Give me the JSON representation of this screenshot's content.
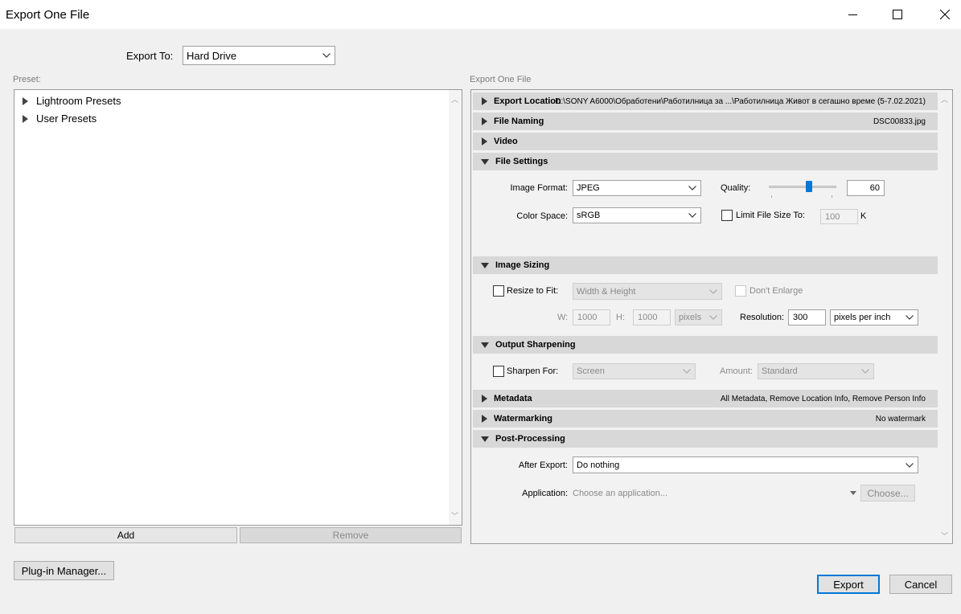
{
  "window": {
    "title": "Export One File"
  },
  "export_to": {
    "label": "Export To:",
    "value": "Hard Drive"
  },
  "preset": {
    "label": "Preset:",
    "items": [
      "Lightroom Presets",
      "User Presets"
    ],
    "add_label": "Add",
    "remove_label": "Remove"
  },
  "plugin_manager_label": "Plug-in Manager...",
  "right": {
    "label": "Export One File",
    "export_location": {
      "title": "Export Location",
      "summary": "D:\\SONY A6000\\Обработени\\Работилница за ...\\Работилница Живот в сегашно време (5-7.02.2021)"
    },
    "file_naming": {
      "title": "File Naming",
      "summary": "DSC00833.jpg"
    },
    "video": {
      "title": "Video"
    },
    "file_settings": {
      "title": "File Settings",
      "image_format_label": "Image Format:",
      "image_format": "JPEG",
      "quality_label": "Quality:",
      "quality": "60",
      "quality_level": 0.6,
      "color_space_label": "Color Space:",
      "color_space": "sRGB",
      "limit_label": "Limit File Size To:",
      "limit_value": "100",
      "limit_unit": "K"
    },
    "image_sizing": {
      "title": "Image Sizing",
      "resize_label": "Resize to Fit:",
      "resize_mode": "Width & Height",
      "dont_enlarge_label": "Don't Enlarge",
      "w_label": "W:",
      "w_value": "1000",
      "h_label": "H:",
      "h_value": "1000",
      "unit": "pixels",
      "resolution_label": "Resolution:",
      "resolution": "300",
      "resolution_unit": "pixels per inch"
    },
    "output_sharpening": {
      "title": "Output Sharpening",
      "sharpen_label": "Sharpen For:",
      "sharpen_for": "Screen",
      "amount_label": "Amount:",
      "amount": "Standard"
    },
    "metadata": {
      "title": "Metadata",
      "summary": "All Metadata, Remove Location Info, Remove Person Info"
    },
    "watermarking": {
      "title": "Watermarking",
      "summary": "No watermark"
    },
    "post_processing": {
      "title": "Post-Processing",
      "after_export_label": "After Export:",
      "after_export": "Do nothing",
      "application_label": "Application:",
      "application_placeholder": "Choose an application...",
      "choose_label": "Choose..."
    }
  },
  "buttons": {
    "export": "Export",
    "cancel": "Cancel"
  }
}
